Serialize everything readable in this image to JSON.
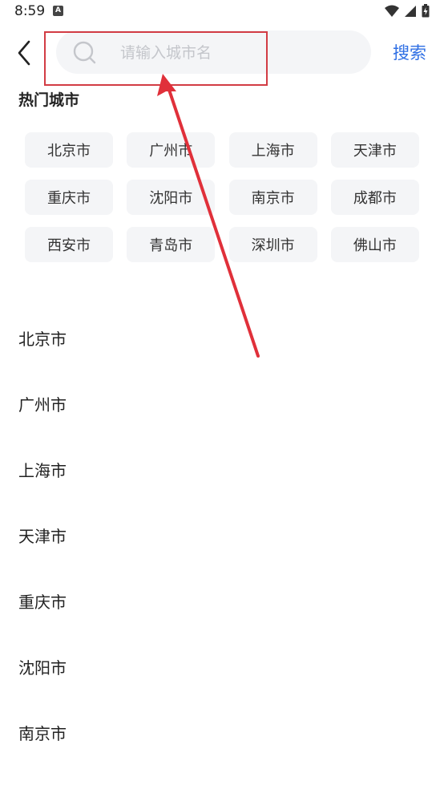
{
  "status_bar": {
    "time": "8:59",
    "app_icon_letter": "A"
  },
  "header": {
    "search_placeholder": "请输入城市名",
    "search_button_label": "搜索"
  },
  "hot_cities": {
    "title": "热门城市",
    "items": [
      "北京市",
      "广州市",
      "上海市",
      "天津市",
      "重庆市",
      "沈阳市",
      "南京市",
      "成都市",
      "西安市",
      "青岛市",
      "深圳市",
      "佛山市"
    ]
  },
  "city_list": {
    "items": [
      "北京市",
      "广州市",
      "上海市",
      "天津市",
      "重庆市",
      "沈阳市",
      "南京市"
    ]
  },
  "colors": {
    "accent": "#2f6fe4",
    "annotation": "#d23c44",
    "chip_bg": "#f4f5f7"
  }
}
